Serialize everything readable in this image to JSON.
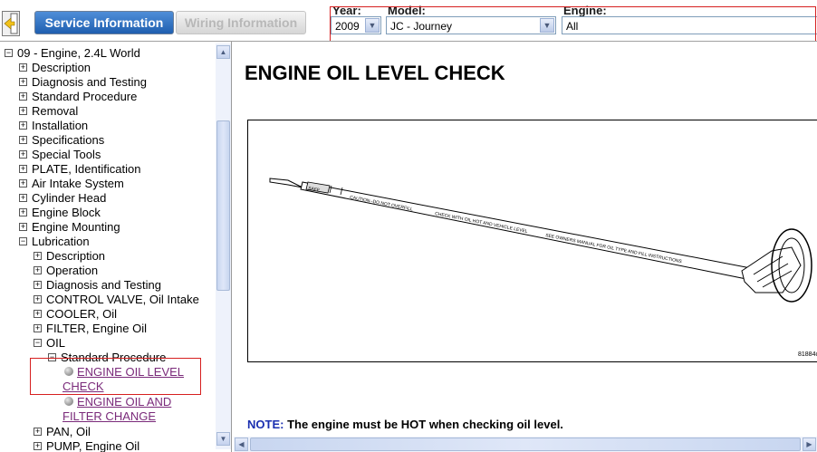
{
  "tabs": {
    "service": "Service Information",
    "wiring": "Wiring Information"
  },
  "filters": {
    "year_label": "Year:",
    "year_value": "2009",
    "model_label": "Model:",
    "model_value": "JC - Journey",
    "engine_label": "Engine:",
    "engine_value": "All"
  },
  "tree": {
    "root": "09 - Engine, 2.4L World",
    "items": [
      "Description",
      "Diagnosis and Testing",
      "Standard Procedure",
      "Removal",
      "Installation",
      "Specifications",
      "Special Tools",
      "PLATE, Identification",
      "Air Intake System",
      "Cylinder Head",
      "Engine Block",
      "Engine Mounting",
      "Lubrication"
    ],
    "lubrication_children": [
      "Description",
      "Operation",
      "Diagnosis and Testing",
      "CONTROL VALVE, Oil Intake",
      "COOLER, Oil",
      "FILTER, Engine Oil",
      "OIL"
    ],
    "oil_child": "Standard Procedure",
    "procedures": [
      {
        "line1": "ENGINE OIL LEVEL",
        "line2": "CHECK"
      },
      {
        "line1": "ENGINE OIL AND",
        "line2": "FILTER CHANGE"
      }
    ],
    "after": [
      "PAN, Oil",
      "PUMP, Engine Oil"
    ]
  },
  "document": {
    "title": "ENGINE OIL LEVEL CHECK",
    "figure": {
      "label_safe": "SAFE",
      "label_caution": "CAUTION--DO NOT OVERFILL",
      "label_check": "CHECK WITH OIL HOT AND VEHICLE LEVEL",
      "label_manual": "SEE OWNERS MANUAL FOR OIL TYPE AND FILL INSTRUCTIONS",
      "code": "81884c"
    },
    "note_label": "NOTE:",
    "note_text": "The engine must be HOT when checking oil level."
  },
  "icons": {
    "expand": "plus-box-icon",
    "collapse": "minus-box-icon",
    "bullet": "sphere-bullet-icon",
    "scroll_up": "arrow-up-icon",
    "scroll_down": "arrow-down-icon",
    "scroll_left": "arrow-left-icon",
    "scroll_right": "arrow-right-icon",
    "dropdown": "chevron-down-icon"
  },
  "colors": {
    "active_tab": "#2c6fc4",
    "highlight_box": "#d62020",
    "note_label": "#1a2fb0",
    "visited_link": "#7a2a7a"
  }
}
